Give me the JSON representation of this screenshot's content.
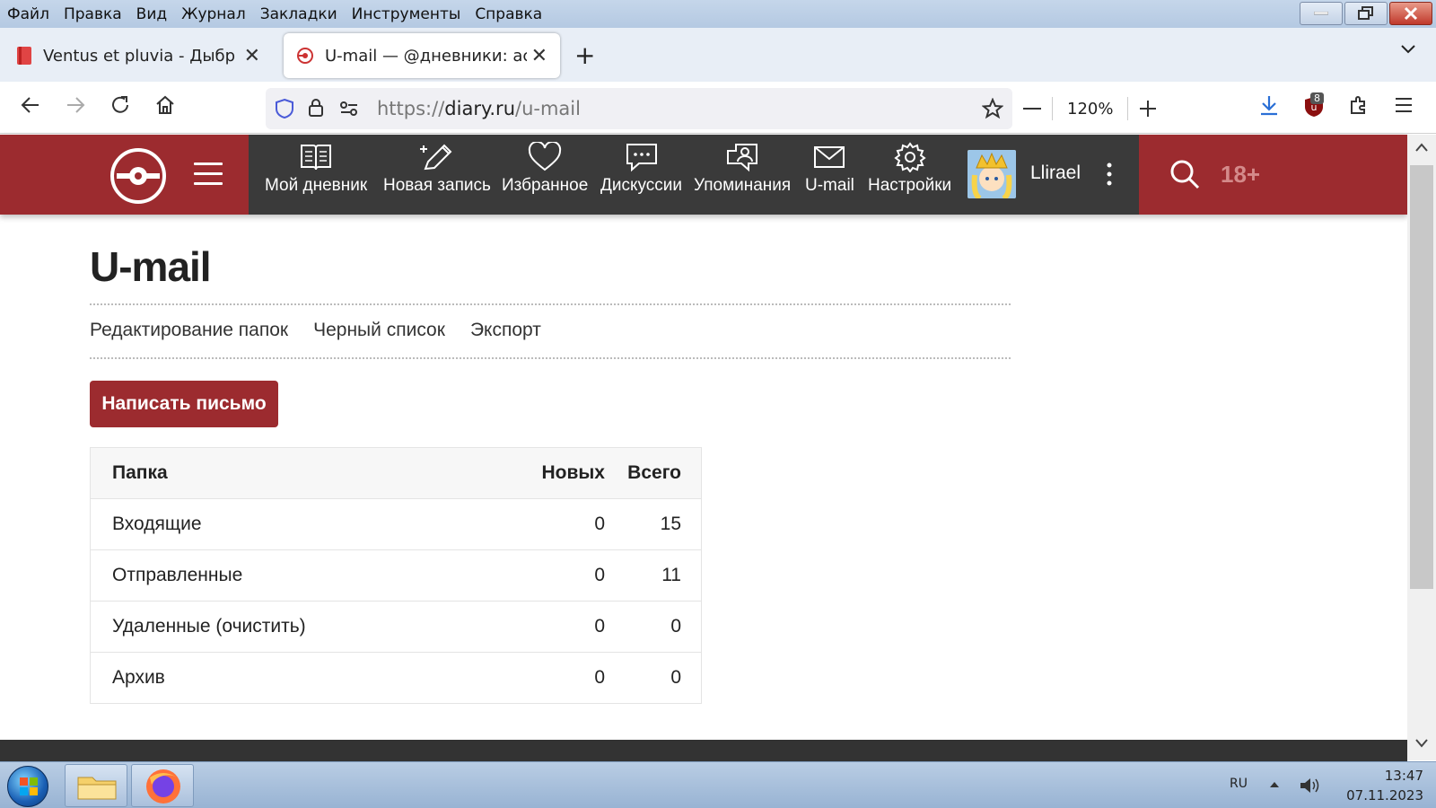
{
  "menubar": {
    "items": [
      "Файл",
      "Правка",
      "Вид",
      "Журнал",
      "Закладки",
      "Инструменты",
      "Справка"
    ]
  },
  "tabs": [
    {
      "title": "Ventus et pluvia - Дыбр",
      "active": false
    },
    {
      "title": "U-mail — @дневники: асоц",
      "active": true
    }
  ],
  "navbar": {
    "url_prefix": "https://",
    "url_domain": "diary.ru",
    "url_path": "/u-mail",
    "zoom": "120%",
    "extension_badge": "8"
  },
  "site": {
    "nav_items": [
      {
        "label": "Мой дневник",
        "icon": "book-icon"
      },
      {
        "label": "Новая запись",
        "icon": "pen-icon"
      },
      {
        "label": "Избранное",
        "icon": "heart-icon"
      },
      {
        "label": "Дискуссии",
        "icon": "chat-icon"
      },
      {
        "label": "Упоминания",
        "icon": "mention-icon"
      },
      {
        "label": "U-mail",
        "icon": "mail-icon"
      },
      {
        "label": "Настройки",
        "icon": "gear-icon"
      }
    ],
    "username": "Llirael",
    "age_badge": "18+",
    "brand_color": "#9c2b2f"
  },
  "page": {
    "title": "U-mail",
    "subnav": [
      "Редактирование папок",
      "Черный список",
      "Экспорт"
    ],
    "compose_button": "Написать письмо"
  },
  "folders": {
    "headers": [
      "Папка",
      "Новых",
      "Всего"
    ],
    "rows": [
      {
        "name": "Входящие",
        "new": "0",
        "total": "15"
      },
      {
        "name": "Отправленные",
        "new": "0",
        "total": "11"
      },
      {
        "name": "Удаленные (очистить)",
        "new": "0",
        "total": "0"
      },
      {
        "name": "Архив",
        "new": "0",
        "total": "0"
      }
    ]
  },
  "taskbar": {
    "lang": "RU",
    "time": "13:47",
    "date": "07.11.2023"
  }
}
